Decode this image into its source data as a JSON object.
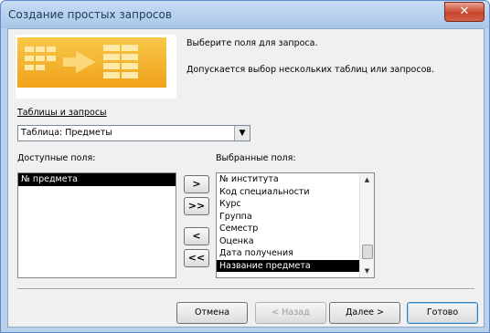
{
  "window": {
    "title": "Создание простых запросов",
    "close_glyph": "✕"
  },
  "info": {
    "line1": "Выберите поля для запроса.",
    "line2": "Допускается выбор нескольких таблиц или запросов."
  },
  "tables": {
    "label": "Таблицы и запросы",
    "selected": "Таблица: Предметы"
  },
  "available": {
    "label": "Доступные поля:",
    "items": [
      "№ предмета"
    ]
  },
  "selected": {
    "label": "Выбранные поля:",
    "items": [
      "№ института",
      "Код специальности",
      "Курс",
      "Группа",
      "Семестр",
      "Оценка",
      "Дата получения",
      "Название предмета"
    ]
  },
  "move_buttons": {
    "add_one": ">",
    "add_all": ">>",
    "remove_one": "<",
    "remove_all": "<<"
  },
  "buttons": {
    "cancel": "Отмена",
    "back": "< Назад",
    "next": "Далее >",
    "finish": "Готово"
  }
}
